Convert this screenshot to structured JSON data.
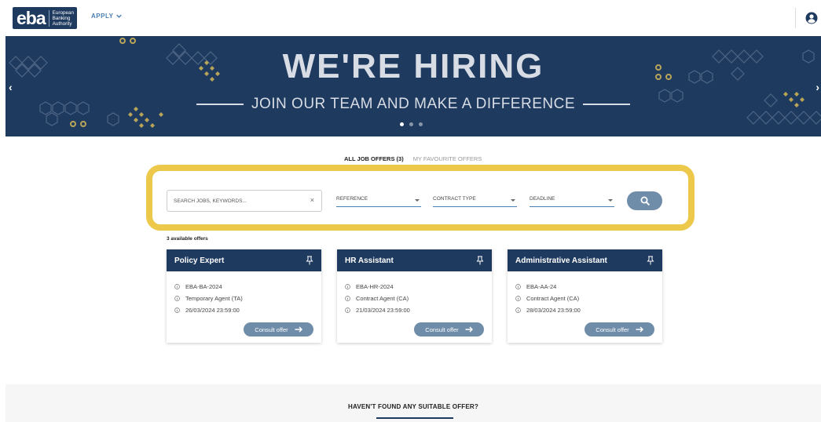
{
  "header": {
    "logo_main": "eba",
    "logo_sub": [
      "European",
      "Banking",
      "Authority"
    ],
    "apply_label": "APPLY"
  },
  "banner": {
    "title": "WE'RE HIRING",
    "subtitle": "JOIN OUR TEAM AND MAKE A DIFFERENCE",
    "slides": 3,
    "active_slide": 1
  },
  "tabs": {
    "all": "ALL JOB OFFERS (3)",
    "favourites": "MY FAVOURITE OFFERS"
  },
  "search": {
    "placeholder": "SEARCH JOBS, KEYWORDS...",
    "clear": "×",
    "reference": "REFERENCE",
    "contract_type": "CONTRACT TYPE",
    "deadline": "DEADLINE"
  },
  "results": {
    "count_label": "3 available offers",
    "offers": [
      {
        "title": "Policy Expert",
        "reference": "EBA-BA-2024",
        "contract": "Temporary Agent (TA)",
        "deadline": "26/03/2024 23:59:00",
        "button": "Consult offer"
      },
      {
        "title": "HR Assistant",
        "reference": "EBA-HR-2024",
        "contract": "Contract Agent (CA)",
        "deadline": "21/03/2024 23:59:00",
        "button": "Consult offer"
      },
      {
        "title": "Administrative Assistant",
        "reference": "EBA-AA-24",
        "contract": "Contract Agent (CA)",
        "deadline": "28/03/2024 23:59:00",
        "button": "Consult offer"
      }
    ]
  },
  "footer": {
    "title": "HAVEN'T FOUND ANY SUITABLE OFFER?"
  },
  "colors": {
    "navy": "#1f3a5f",
    "highlight": "#ecc94b",
    "button": "#6f8ca8",
    "link": "#4a7fb5"
  }
}
